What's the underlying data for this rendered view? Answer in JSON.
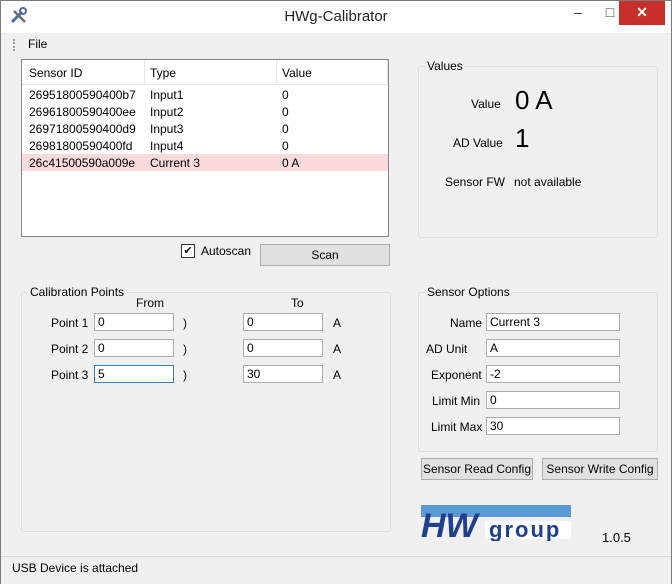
{
  "window": {
    "title": "HWg-Calibrator",
    "minimize": "–",
    "maximize": "□",
    "close": "✕"
  },
  "menu": {
    "file_label": "File"
  },
  "sensor_list": {
    "headers": [
      "Sensor ID",
      "Type",
      "Value"
    ],
    "rows": [
      {
        "id": "26951800590400b7",
        "type": "Input1",
        "value": "0"
      },
      {
        "id": "26961800590400ee",
        "type": "Input2",
        "value": "0"
      },
      {
        "id": "26971800590400d9",
        "type": "Input3",
        "value": "0"
      },
      {
        "id": "26981800590400fd",
        "type": "Input4",
        "value": "0"
      },
      {
        "id": "26c41500590a009e",
        "type": "Current 3",
        "value": "0 A",
        "selected": true
      }
    ]
  },
  "autoscan": {
    "label": "Autoscan",
    "checked": true,
    "check_glyph": "✔"
  },
  "scan_button": "Scan",
  "values": {
    "title": "Values",
    "value_label": "Value",
    "value": "0 A",
    "ad_label": "AD Value",
    "ad_value": "1",
    "fw_label": "Sensor FW",
    "fw_value": "not available"
  },
  "calibration": {
    "title": "Calibration Points",
    "from_header": "From",
    "to_header": "To",
    "points": [
      {
        "label": "Point 1",
        "from": "0",
        "paren": ")",
        "to": "0",
        "unit": "A"
      },
      {
        "label": "Point 2",
        "from": "0",
        "paren": ")",
        "to": "0",
        "unit": "A"
      },
      {
        "label": "Point 3",
        "from": "5",
        "paren": ")",
        "to": "30",
        "unit": "A"
      }
    ]
  },
  "sensor_options": {
    "title": "Sensor Options",
    "name_label": "Name",
    "name": "Current 3",
    "ad_unit_label": "AD Unit",
    "ad_unit": "A",
    "exponent_label": "Exponent",
    "exponent": "-2",
    "limit_min_label": "Limit Min",
    "limit_min": "0",
    "limit_max_label": "Limit Max",
    "limit_max": "30"
  },
  "buttons": {
    "read_config": "Sensor Read Config",
    "write_config": "Sensor Write Config"
  },
  "logo": {
    "text_hw": "HW",
    "text_group": "group",
    "color": "#1f3f8f",
    "accent": "#5b9bd5"
  },
  "version": "1.0.5",
  "status": "USB Device is attached",
  "colors": {
    "selected_row": "#fadadb",
    "close_button": "#c7302a"
  }
}
